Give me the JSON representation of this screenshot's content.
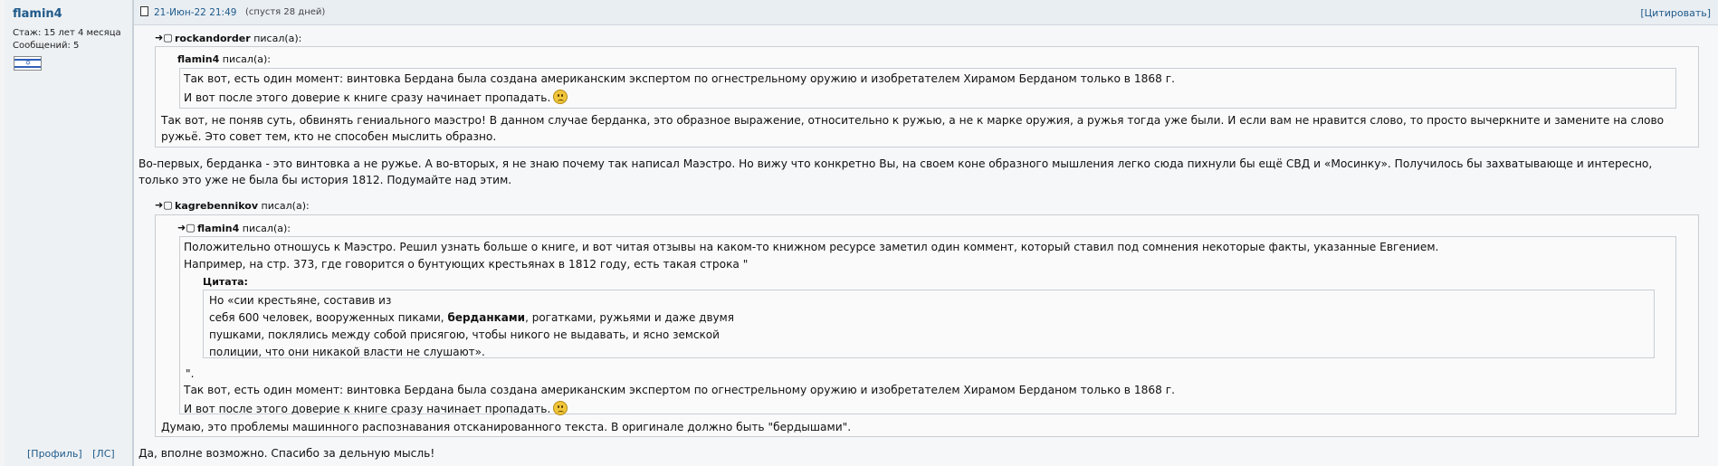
{
  "sidebar": {
    "username": "flamin4",
    "tenure": "Стаж: 15 лет 4 месяца",
    "posts": "Сообщений: 5",
    "flag_icon": "israel-flag-icon",
    "profile_label": "[Профиль]",
    "pm_label": "[ЛС]"
  },
  "post_header": {
    "icon": "post-icon",
    "date": "21-Июн-22 21:49",
    "ago": "(спустя 28 дней)",
    "quote_button": "[Цитировать]"
  },
  "quote1": {
    "author": "rockandorder",
    "said": "писал(а):",
    "nested": {
      "author": "flamin4",
      "said": "писал(а):",
      "lines": [
        "Так вот, есть один момент: винтовка Бердана была создана американским экспертом по огнестрельному оружию и изобретателем Хирамом Берданом только в 1868 г.",
        "И вот после этого доверие к книге сразу начинает пропадать."
      ]
    },
    "reply_lines": [
      "Так вот, не поняв суть, обвинять гениального маэстро! В данном случае берданка, это образное выражение, относительно к ружью, а не к марке оружия, а ружья тогда уже были. И если вам не нравится слово, то просто вычеркните и замените на слово",
      "ружьё. Это совет тем, кто не способен мыслить образно."
    ]
  },
  "body1": [
    "Во-первых, берданка - это винтовка а не ружье. А во-вторых, я не знаю почему так написал Маэстро. Но вижу что конкретно Вы, на своем коне образного мышления легко сюда пихнули бы ещё СВД и «Мосинку». Получилось бы захватывающе и интересно,",
    "только это уже не была бы история 1812. Подумайте над этим."
  ],
  "quote2": {
    "author": "kagrebennikov",
    "said": "писал(а):",
    "nested": {
      "author": "flamin4",
      "said": "писал(а):",
      "lines": [
        "Положительно отношусь к Маэстро. Решил узнать больше о книге, и вот читая отзывы на каком-то книжном ресурсе заметил один коммент, который ставил под сомнения некоторые факты, указанные Евгением.",
        "Например, на стр. 373, где говорится о бунтующих крестьянах в 1812 году, есть такая строка \""
      ],
      "cite_label": "Цитата:",
      "cite": {
        "line1": "Но «сии крестьяне, составив из",
        "line2_pre": "себя 600 человек, вооруженных пиками, ",
        "line2_bold": "берданками",
        "line2_post": ", рогатками, ружьями и даже двумя",
        "line3": "пушками, поклялись между собой присягою, чтобы никого не выдавать, и ясно земской",
        "line4": "полиции, что они никакой власти не слушают»."
      },
      "after_cite": "\".",
      "lines2": [
        "Так вот, есть один момент: винтовка Бердана была создана американским экспертом по огнестрельному оружию и изобретателем Хирамом Берданом только в 1868 г.",
        "И вот после этого доверие к книге сразу начинает пропадать."
      ]
    },
    "reply": "Думаю, это проблемы машинного распознавания отсканированного текста. В оригинале должно быть \"бердышами\"."
  },
  "body2": "Да, вполне возможно. Спасибо за дельную мысль!",
  "smiley_icon": "sad-smiley-icon"
}
